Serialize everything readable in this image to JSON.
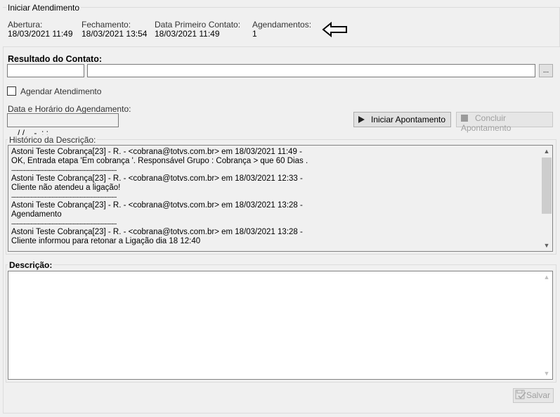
{
  "header": {
    "title": "Iniciar Atendimento",
    "abertura_label": "Abertura:",
    "abertura_value": "18/03/2021 11:49",
    "fechamento_label": "Fechamento:",
    "fechamento_value": "18/03/2021 13:54",
    "primeiro_contato_label": "Data Primeiro Contato:",
    "primeiro_contato_value": "18/03/2021 11:49",
    "agendamentos_label": "Agendamentos:",
    "agendamentos_value": "1"
  },
  "resultado": {
    "label": "Resultado do Contato:",
    "code_value": "",
    "desc_value": "",
    "lookup_label": "..."
  },
  "agendar": {
    "label": "Agendar Atendimento",
    "checked": false
  },
  "agendamento": {
    "label": "Data e Horário do Agendamento:",
    "value": " / /    -  : :"
  },
  "actions": {
    "iniciar_label": "Iniciar Apontamento",
    "concluir_label": "Concluir Apontamento",
    "salvar_label": "Salvar"
  },
  "historico": {
    "label": "Histórico da Descrição:",
    "separator": "----------------------------------------------------------------------------",
    "entries": [
      {
        "header": "Astoni Teste Cobrança[23] - R. - <cobrana@totvs.com.br> em 18/03/2021 11:49 -",
        "text": "OK, Entrada etapa 'Em cobrança '. Responsável Grupo : Cobrança > que 60 Dias ."
      },
      {
        "header": "Astoni Teste Cobrança[23] - R. - <cobrana@totvs.com.br> em 18/03/2021 12:33 -",
        "text": "Cliente não atendeu a ligação!"
      },
      {
        "header": "Astoni Teste Cobrança[23] - R. - <cobrana@totvs.com.br> em 18/03/2021 13:28 -",
        "text": "Agendamento"
      },
      {
        "header": "Astoni Teste Cobrança[23] - R. - <cobrana@totvs.com.br> em 18/03/2021 13:28 -",
        "text": "Cliente informou para retonar a Ligação dia 18 12:40"
      }
    ]
  },
  "descricao": {
    "label": "Descrição:",
    "value": ""
  },
  "icons": {
    "arrow": "left-arrow-icon",
    "play": "play-icon",
    "stop": "stop-icon",
    "save": "save-check-icon"
  }
}
